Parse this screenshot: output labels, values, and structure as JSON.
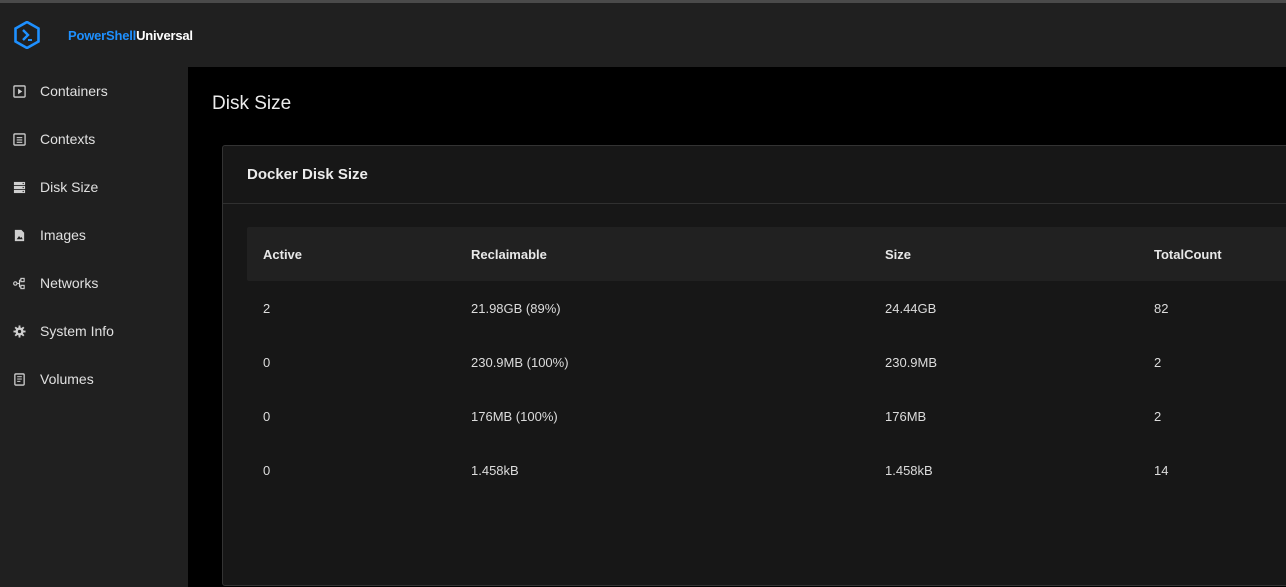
{
  "app": {
    "brand_part1": "PowerShell",
    "brand_part2": "Universal",
    "brand_color": "#1e90ff"
  },
  "sidebar": {
    "items": [
      {
        "label": "Containers",
        "icon": "play-square-icon"
      },
      {
        "label": "Contexts",
        "icon": "list-box-icon"
      },
      {
        "label": "Disk Size",
        "icon": "storage-icon"
      },
      {
        "label": "Images",
        "icon": "file-image-icon"
      },
      {
        "label": "Networks",
        "icon": "network-nodes-icon"
      },
      {
        "label": "System Info",
        "icon": "gear-icon"
      },
      {
        "label": "Volumes",
        "icon": "volume-file-icon"
      }
    ]
  },
  "page": {
    "title": "Disk Size"
  },
  "card": {
    "title": "Docker Disk Size"
  },
  "table": {
    "columns": [
      "Active",
      "Reclaimable",
      "Size",
      "TotalCount"
    ],
    "rows": [
      [
        "2",
        "21.98GB (89%)",
        "24.44GB",
        "82"
      ],
      [
        "0",
        "230.9MB (100%)",
        "230.9MB",
        "2"
      ],
      [
        "0",
        "176MB (100%)",
        "176MB",
        "2"
      ],
      [
        "0",
        "1.458kB",
        "1.458kB",
        "14"
      ]
    ]
  }
}
